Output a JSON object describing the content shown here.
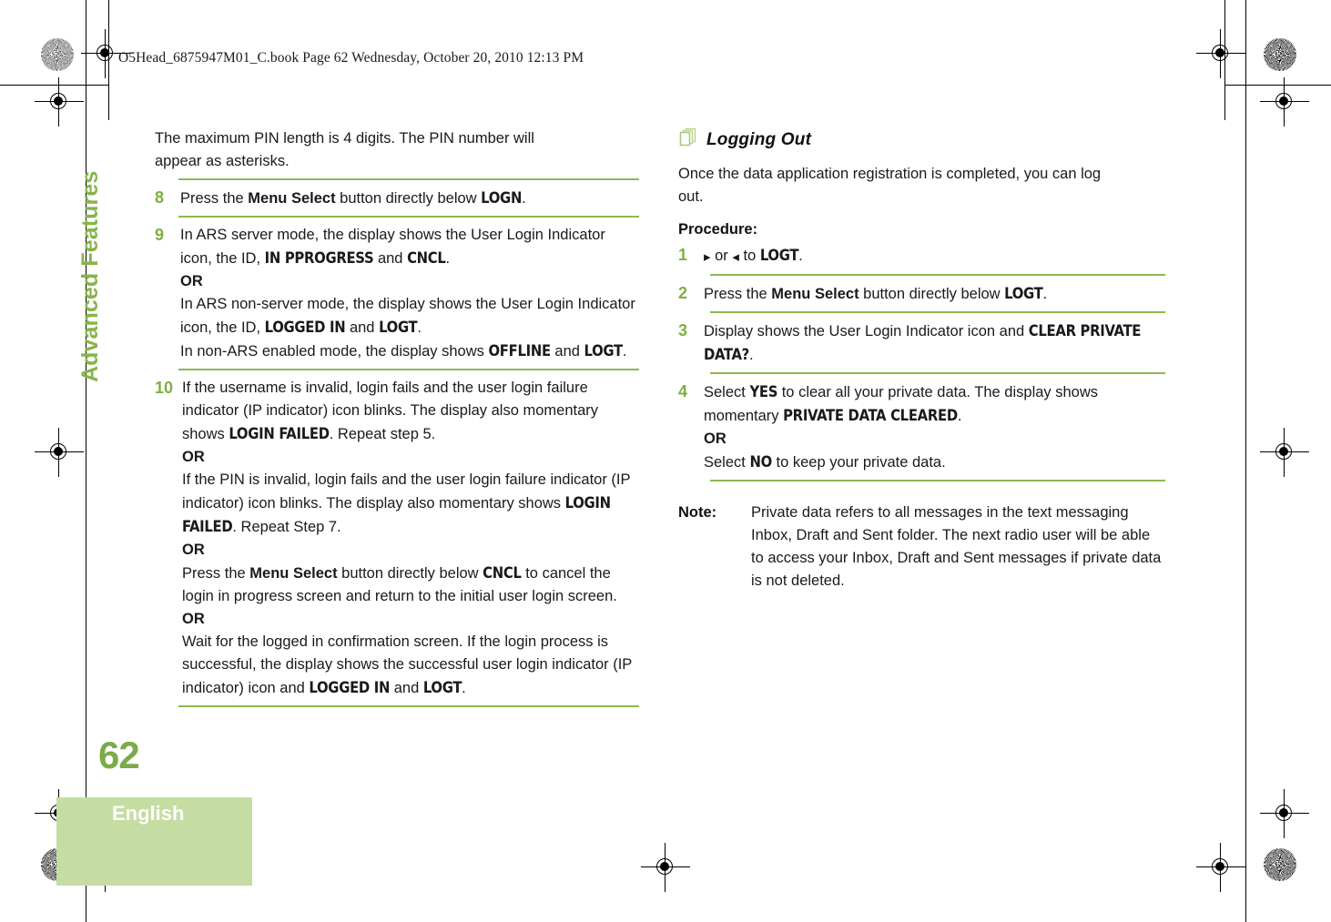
{
  "header": {
    "slug": "O5Head_6875947M01_C.book  Page 62  Wednesday, October 20, 2010  12:13 PM"
  },
  "sidebar": {
    "chapter_label": "Advanced Features",
    "page_number": "62",
    "language": "English",
    "accent_color": "#87b44a",
    "folio_color": "#7cab49",
    "language_box_color": "#c5dda2"
  },
  "theme": {
    "rule_color": "#8eb850",
    "step_number_color": "#7fae43",
    "text_color": "#1a1a1a"
  },
  "left_column": {
    "intro": {
      "line1": "The maximum PIN length is 4 digits. The PIN number will",
      "line2": "appear as asterisks."
    },
    "steps": [
      {
        "number": "8",
        "segments": [
          {
            "text": "Press the ",
            "style": "normal"
          },
          {
            "text": "Menu Select",
            "style": "bold"
          },
          {
            "text": " button directly below ",
            "style": "normal"
          },
          {
            "text": "LOGN",
            "style": "display"
          },
          {
            "text": ".",
            "style": "normal"
          }
        ]
      },
      {
        "number": "9",
        "segments": [
          {
            "text": "In ARS server mode, the display shows the User Login Indicator icon, the ID, ",
            "style": "normal"
          },
          {
            "text": "IN PPROGRESS",
            "style": "display"
          },
          {
            "text": " and ",
            "style": "normal"
          },
          {
            "text": "CNCL",
            "style": "display"
          },
          {
            "text": ".",
            "style": "normal"
          },
          {
            "text": "OR",
            "style": "bold-break"
          },
          {
            "text": "In ARS non-server mode, the display shows the User Login Indicator icon, the ID, ",
            "style": "normal-break"
          },
          {
            "text": "LOGGED IN",
            "style": "display"
          },
          {
            "text": " and ",
            "style": "normal"
          },
          {
            "text": "LOGT",
            "style": "display"
          },
          {
            "text": ".",
            "style": "normal"
          },
          {
            "text": "In non-ARS enabled mode, the display shows ",
            "style": "normal-break"
          },
          {
            "text": "OFFLINE",
            "style": "display"
          },
          {
            "text": " and ",
            "style": "normal"
          },
          {
            "text": "LOGT",
            "style": "display"
          },
          {
            "text": ".",
            "style": "normal"
          }
        ]
      },
      {
        "number": "10",
        "segments": [
          {
            "text": "If the username is invalid, login fails and the user login failure indicator (IP indicator) icon blinks. The display also momentary shows ",
            "style": "normal"
          },
          {
            "text": "LOGIN FAILED",
            "style": "display"
          },
          {
            "text": ". Repeat step 5.",
            "style": "normal"
          },
          {
            "text": "OR",
            "style": "bold-break"
          },
          {
            "text": "If the PIN is invalid, login fails and the user login failure indicator (IP indicator) icon blinks. The display also momentary shows ",
            "style": "normal-break"
          },
          {
            "text": "LOGIN FAILED",
            "style": "display"
          },
          {
            "text": ". Repeat Step 7.",
            "style": "normal"
          },
          {
            "text": "OR",
            "style": "bold-break"
          },
          {
            "text": "Press the ",
            "style": "normal-break"
          },
          {
            "text": "Menu Select",
            "style": "bold"
          },
          {
            "text": " button directly below ",
            "style": "normal"
          },
          {
            "text": "CNCL",
            "style": "display"
          },
          {
            "text": " to cancel the login in progress screen and return to the initial user login screen.",
            "style": "normal"
          },
          {
            "text": "OR",
            "style": "bold-break"
          },
          {
            "text": "Wait for the logged in confirmation screen. If the login process is successful, the display shows the successful user login indicator (IP indicator) icon and ",
            "style": "normal-break"
          },
          {
            "text": "LOGGED IN",
            "style": "display"
          },
          {
            "text": " and ",
            "style": "normal"
          },
          {
            "text": "LOGT",
            "style": "display"
          },
          {
            "text": ".",
            "style": "normal"
          }
        ]
      }
    ]
  },
  "right_column": {
    "section": {
      "icon": "stacked-pages-icon",
      "title": "Logging Out",
      "body_line1": "Once the data application registration is completed, you can log",
      "body_line2": "out."
    },
    "procedure_label": "Procedure:",
    "steps": [
      {
        "number": "1",
        "segments": [
          {
            "text": "▸",
            "style": "arrow"
          },
          {
            "text": " or ",
            "style": "normal"
          },
          {
            "text": "◂",
            "style": "arrow"
          },
          {
            "text": " to ",
            "style": "normal"
          },
          {
            "text": "LOGT",
            "style": "display"
          },
          {
            "text": ".",
            "style": "normal"
          }
        ]
      },
      {
        "number": "2",
        "segments": [
          {
            "text": "Press the ",
            "style": "normal"
          },
          {
            "text": "Menu Select",
            "style": "bold"
          },
          {
            "text": " button directly below ",
            "style": "normal"
          },
          {
            "text": "LOGT",
            "style": "display"
          },
          {
            "text": ".",
            "style": "normal"
          }
        ]
      },
      {
        "number": "3",
        "segments": [
          {
            "text": "Display shows the User Login Indicator icon and ",
            "style": "normal"
          },
          {
            "text": "CLEAR PRIVATE DATA?",
            "style": "display"
          },
          {
            "text": ".",
            "style": "normal"
          }
        ]
      },
      {
        "number": "4",
        "segments": [
          {
            "text": "Select ",
            "style": "normal"
          },
          {
            "text": "YES",
            "style": "display"
          },
          {
            "text": " to clear all your private data. The display shows momentary ",
            "style": "normal"
          },
          {
            "text": "PRIVATE DATA CLEARED",
            "style": "display"
          },
          {
            "text": ".",
            "style": "normal"
          },
          {
            "text": "OR",
            "style": "bold-break"
          },
          {
            "text": "Select ",
            "style": "normal-break"
          },
          {
            "text": "NO",
            "style": "display"
          },
          {
            "text": " to keep your private data.",
            "style": "normal"
          }
        ]
      }
    ],
    "note": {
      "label": "Note:",
      "text": "Private data refers to all messages in the text messaging Inbox, Draft and Sent folder. The next radio user will be able to access your Inbox, Draft and Sent messages if private data is not deleted."
    }
  }
}
